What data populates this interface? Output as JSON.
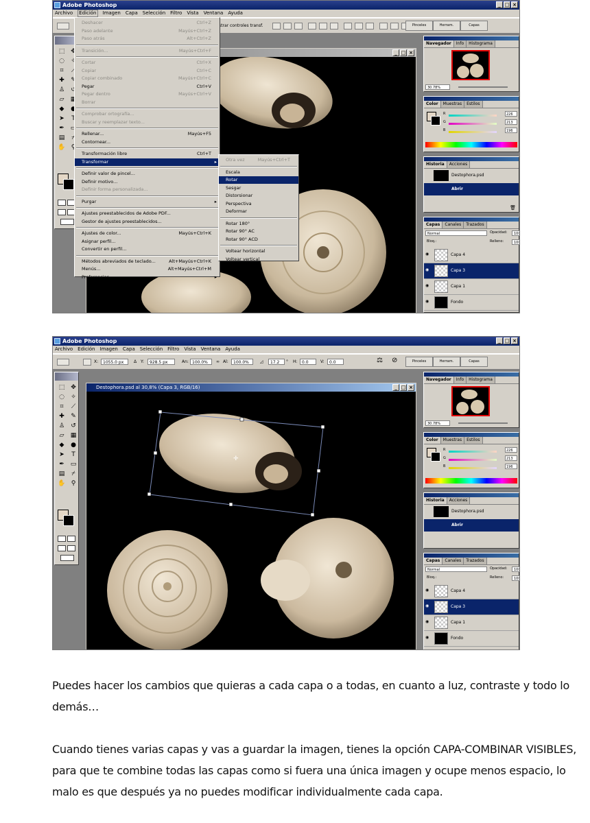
{
  "app_title": "Adobe Photoshop",
  "menubar": [
    "Archivo",
    "Edición",
    "Imagen",
    "Capa",
    "Selección",
    "Filtro",
    "Vista",
    "Ventana",
    "Ayuda"
  ],
  "window_buttons": [
    "_",
    "□",
    "×"
  ],
  "shot1": {
    "options_text": "strar controles transf.",
    "palette_well": [
      "Pinceles",
      "Herram. preest.",
      "Capas"
    ],
    "edit_menu": [
      {
        "label": "Deshacer",
        "shortcut": "Ctrl+Z",
        "state": "disabled"
      },
      {
        "label": "Paso adelante",
        "shortcut": "Mayús+Ctrl+Z",
        "state": "disabled"
      },
      {
        "label": "Paso atrás",
        "shortcut": "Alt+Ctrl+Z",
        "state": "disabled"
      },
      {
        "label": "Transición...",
        "shortcut": "Mayús+Ctrl+F",
        "state": "disabled"
      },
      {
        "label": "Cortar",
        "shortcut": "Ctrl+X",
        "state": "disabled"
      },
      {
        "label": "Copiar",
        "shortcut": "Ctrl+C",
        "state": "disabled"
      },
      {
        "label": "Copiar combinado",
        "shortcut": "Mayús+Ctrl+C",
        "state": "disabled"
      },
      {
        "label": "Pegar",
        "shortcut": "Ctrl+V",
        "state": "enabled"
      },
      {
        "label": "Pegar dentro",
        "shortcut": "Mayús+Ctrl+V",
        "state": "disabled"
      },
      {
        "label": "Borrar",
        "shortcut": "",
        "state": "disabled"
      },
      {
        "label": "Comprobar ortografía...",
        "shortcut": "",
        "state": "disabled"
      },
      {
        "label": "Buscar y reemplazar texto...",
        "shortcut": "",
        "state": "disabled"
      },
      {
        "label": "Rellenar...",
        "shortcut": "Mayús+F5",
        "state": "enabled"
      },
      {
        "label": "Contornear...",
        "shortcut": "",
        "state": "enabled"
      },
      {
        "label": "Transformación libre",
        "shortcut": "Ctrl+T",
        "state": "enabled"
      },
      {
        "label": "Transformar",
        "shortcut": "",
        "state": "highlighted"
      },
      {
        "label": "Definir valor de pincel...",
        "shortcut": "",
        "state": "enabled"
      },
      {
        "label": "Definir motivo...",
        "shortcut": "",
        "state": "enabled"
      },
      {
        "label": "Definir forma personalizada...",
        "shortcut": "",
        "state": "disabled"
      },
      {
        "label": "Purgar",
        "shortcut": "",
        "state": "enabled"
      },
      {
        "label": "Ajustes preestablecidos de Adobe PDF...",
        "shortcut": "",
        "state": "enabled"
      },
      {
        "label": "Gestor de ajustes preestablecidos...",
        "shortcut": "",
        "state": "enabled"
      },
      {
        "label": "Ajustes de color...",
        "shortcut": "Mayús+Ctrl+K",
        "state": "enabled"
      },
      {
        "label": "Asignar perfil...",
        "shortcut": "",
        "state": "enabled"
      },
      {
        "label": "Convertir en perfil...",
        "shortcut": "",
        "state": "enabled"
      },
      {
        "label": "Métodos abreviados de teclado...",
        "shortcut": "Alt+Mayús+Ctrl+K",
        "state": "enabled"
      },
      {
        "label": "Menús...",
        "shortcut": "Alt+Mayús+Ctrl+M",
        "state": "enabled"
      },
      {
        "label": "Preferencias",
        "shortcut": "",
        "state": "enabled"
      }
    ],
    "transform_submenu": [
      {
        "label": "Otra vez",
        "shortcut": "Mayús+Ctrl+T",
        "state": "disabled"
      },
      {
        "label": "Escala",
        "shortcut": "",
        "state": "enabled"
      },
      {
        "label": "Rotar",
        "shortcut": "",
        "state": "highlighted"
      },
      {
        "label": "Sesgar",
        "shortcut": "",
        "state": "enabled"
      },
      {
        "label": "Distorsionar",
        "shortcut": "",
        "state": "enabled"
      },
      {
        "label": "Perspectiva",
        "shortcut": "",
        "state": "enabled"
      },
      {
        "label": "Deformar",
        "shortcut": "",
        "state": "enabled"
      },
      {
        "label": "Rotar 180°",
        "shortcut": "",
        "state": "enabled"
      },
      {
        "label": "Rotar 90° AC",
        "shortcut": "",
        "state": "enabled"
      },
      {
        "label": "Rotar 90° ACD",
        "shortcut": "",
        "state": "enabled"
      },
      {
        "label": "Voltear horizontal",
        "shortcut": "",
        "state": "enabled"
      },
      {
        "label": "Voltear vertical",
        "shortcut": "",
        "state": "enabled"
      }
    ]
  },
  "shot2": {
    "doc_title": "Destophora.psd al 30,8% (Capa 3, RGB/16)",
    "options": {
      "x_label": "X:",
      "x_value": "1055.0 px",
      "y_label": "Y:",
      "y_value": "928.5 px",
      "w_label": "An:",
      "w_value": "100.0%",
      "h_label": "Al:",
      "h_value": "100.0%",
      "angle_value": "17.2",
      "angle_unit": "°",
      "hskew_label": "H:",
      "hskew_value": "0.0",
      "vskew_label": "V:",
      "vskew_value": "0.0"
    },
    "palette_well": [
      "Pinceles",
      "Herram. preest.",
      "Capas"
    ]
  },
  "panels": {
    "navigator_tabs": [
      "Navegador",
      "Info",
      "Histograma"
    ],
    "zoom": "30.78%",
    "color_tabs": [
      "Color",
      "Muestras",
      "Estilos"
    ],
    "color_channels": [
      {
        "name": "R",
        "value": "226"
      },
      {
        "name": "G",
        "value": "213"
      },
      {
        "name": "B",
        "value": "196"
      }
    ],
    "history_tabs": [
      "Historia",
      "Acciones"
    ],
    "history_file": "Destophora.psd",
    "history_step": "Abrir",
    "layers_tabs": [
      "Capas",
      "Canales",
      "Trazados"
    ],
    "blend_mode": "Normal",
    "opacity_label": "Opacidad:",
    "opacity_value": "100",
    "lock_label": "Bloq.:",
    "fill_label": "Relleno:",
    "fill_value": "100",
    "layers": [
      {
        "name": "Capa 4",
        "selected": false
      },
      {
        "name": "Capa 3",
        "selected": true
      },
      {
        "name": "Capa 1",
        "selected": false
      },
      {
        "name": "Fondo",
        "selected": false
      }
    ]
  },
  "text": {
    "paragraph1": "Puedes hacer los cambios que quieras a cada capa o a todas, en cuanto a luz, contraste y todo lo demás…",
    "paragraph2": "Cuando tienes varias capas y vas a guardar la imagen, tienes la opción CAPA-COMBINAR VISIBLES, para que te combine todas las capas como si fuera una única imagen y ocupe menos espacio, lo malo es que después ya no puedes modificar individualmente cada capa."
  },
  "colors": {
    "selection": "#0a246a",
    "menu_bg": "#d4d0c8",
    "workspace": "#808080",
    "foreground": "#e2d5c4"
  }
}
